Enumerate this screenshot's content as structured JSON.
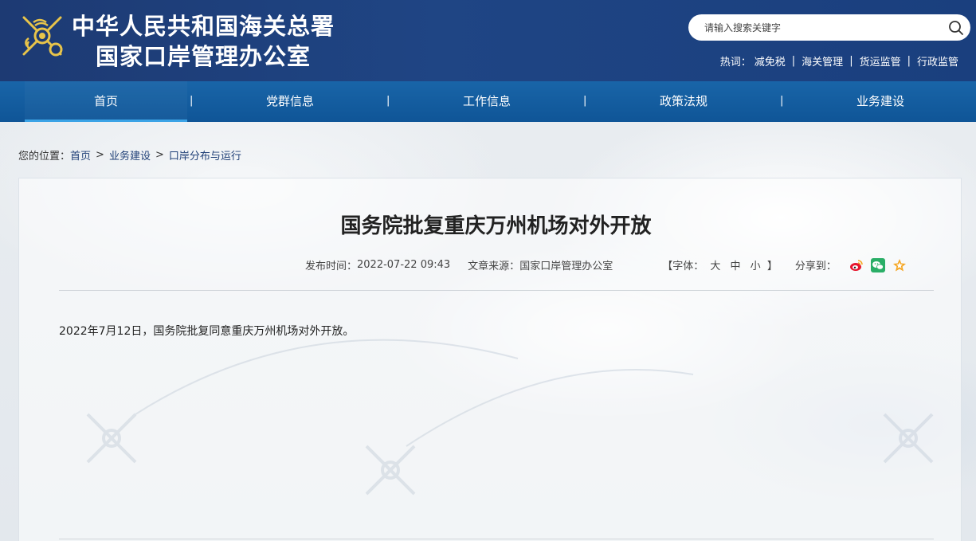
{
  "header": {
    "title_line1": "中华人民共和国海关总署",
    "title_line2": "国家口岸管理办公室",
    "search": {
      "placeholder": "请输入搜索关键字"
    },
    "hotwords": {
      "label": "热词：",
      "items": [
        "减免税",
        "海关管理",
        "货运监管",
        "行政监管"
      ],
      "separator": "|"
    }
  },
  "nav": {
    "items": [
      {
        "label": "首页",
        "active": true
      },
      {
        "label": "党群信息",
        "active": false
      },
      {
        "label": "工作信息",
        "active": false
      },
      {
        "label": "政策法规",
        "active": false
      },
      {
        "label": "业务建设",
        "active": false
      }
    ],
    "separator": "|"
  },
  "breadcrumb": {
    "label": "您的位置：",
    "items": [
      "首页",
      "业务建设",
      "口岸分布与运行"
    ],
    "arrow": ">"
  },
  "article": {
    "title": "国务院批复重庆万州机场对外开放",
    "publish_label": "发布时间：",
    "publish_time": "2022-07-22 09:43",
    "source_label": "文章来源：",
    "source": "国家口岸管理办公室",
    "fontsize_open": "【字体：",
    "fontsize_large": "大",
    "fontsize_medium": "中",
    "fontsize_small": "小",
    "fontsize_close": "】",
    "share_label": "分享到：",
    "share_icons": [
      "weibo-icon",
      "wechat-icon",
      "favorite-icon"
    ],
    "body": "2022年7月12日，国务院批复同意重庆万州机场对外开放。"
  },
  "colors": {
    "header_bg": "#1d3a73",
    "nav_bg": "#1965a8",
    "nav_active_underline": "#3ba3e6",
    "link": "#1f3f77",
    "weibo": "#e6162d",
    "wechat": "#2aae67",
    "favorite": "#f5a623"
  }
}
